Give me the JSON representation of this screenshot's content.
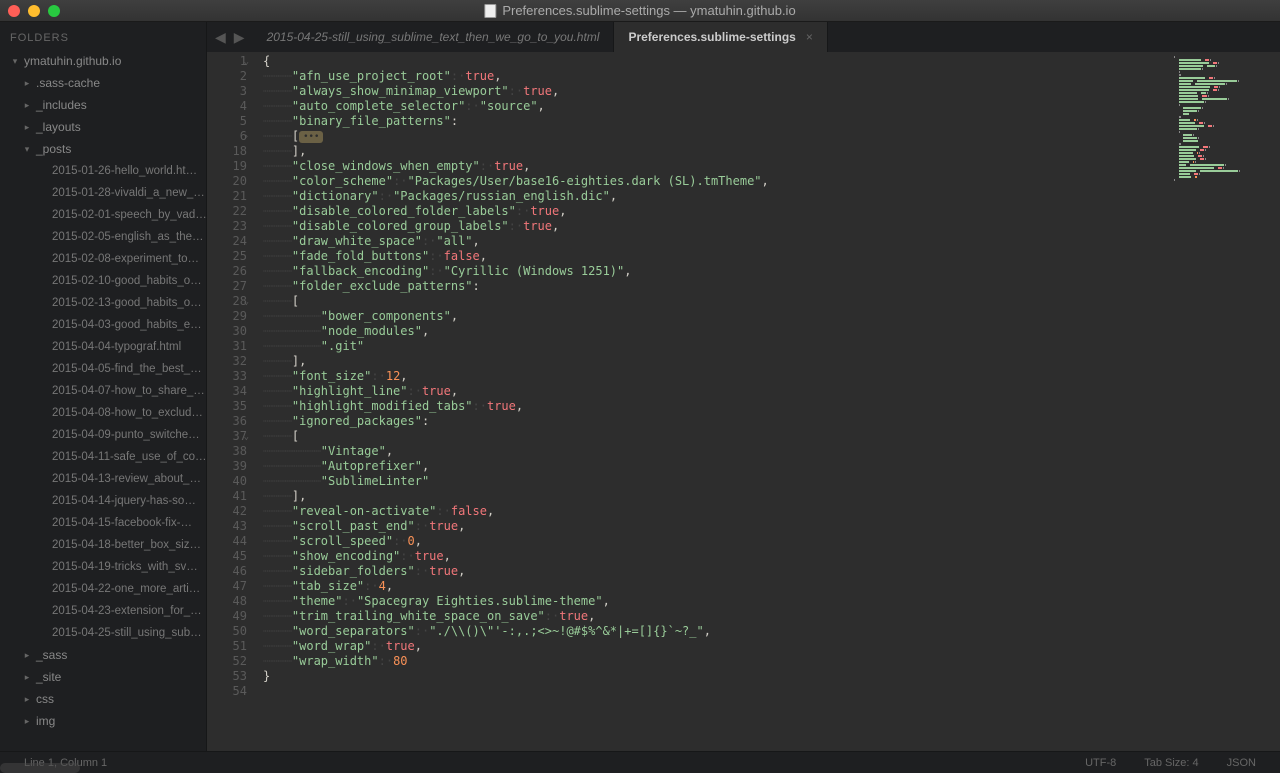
{
  "window": {
    "title": "Preferences.sublime-settings — ymatuhin.github.io"
  },
  "sidebar": {
    "header": "FOLDERS",
    "root": "ymatuhin.github.io",
    "folders": [
      {
        "name": ".sass-cache",
        "expanded": false
      },
      {
        "name": "_includes",
        "expanded": false
      },
      {
        "name": "_layouts",
        "expanded": false
      },
      {
        "name": "_posts",
        "expanded": true
      },
      {
        "name": "_sass",
        "expanded": false
      },
      {
        "name": "_site",
        "expanded": false
      },
      {
        "name": "css",
        "expanded": false
      },
      {
        "name": "img",
        "expanded": false
      }
    ],
    "posts": [
      "2015-01-26-hello_world.ht…",
      "2015-01-28-vivaldi_a_new_…",
      "2015-02-01-speech_by_vad…",
      "2015-02-05-english_as_the…",
      "2015-02-08-experiment_to…",
      "2015-02-10-good_habits_o…",
      "2015-02-13-good_habits_o…",
      "2015-04-03-good_habits_e…",
      "2015-04-04-typograf.html",
      "2015-04-05-find_the_best_…",
      "2015-04-07-how_to_share_…",
      "2015-04-08-how_to_exclud…",
      "2015-04-09-punto_switche…",
      "2015-04-11-safe_use_of_co…",
      "2015-04-13-review_about_…",
      "2015-04-14-jquery-has-so…",
      "2015-04-15-facebook-fix-…",
      "2015-04-18-better_box_siz…",
      "2015-04-19-tricks_with_sv…",
      "2015-04-22-one_more_arti…",
      "2015-04-23-extension_for_…",
      "2015-04-25-still_using_sub…"
    ]
  },
  "tabs": {
    "inactive": "2015-04-25-still_using_sublime_text_then_we_go_to_you.html",
    "active": "Preferences.sublime-settings"
  },
  "code": [
    {
      "n": "1",
      "fold": "down",
      "tokens": [
        {
          "t": "{",
          "c": "punct"
        }
      ]
    },
    {
      "n": "2",
      "tokens": [
        {
          "t": "····",
          "c": "ws"
        },
        {
          "t": "\"afn_use_project_root\"",
          "c": "key"
        },
        {
          "t": ":·",
          "c": "ws"
        },
        {
          "t": "true",
          "c": "bool"
        },
        {
          "t": ",",
          "c": "punct"
        }
      ]
    },
    {
      "n": "3",
      "tokens": [
        {
          "t": "····",
          "c": "ws"
        },
        {
          "t": "\"always_show_minimap_viewport\"",
          "c": "key"
        },
        {
          "t": ":·",
          "c": "ws"
        },
        {
          "t": "true",
          "c": "bool"
        },
        {
          "t": ",",
          "c": "punct"
        }
      ]
    },
    {
      "n": "4",
      "tokens": [
        {
          "t": "····",
          "c": "ws"
        },
        {
          "t": "\"auto_complete_selector\"",
          "c": "key"
        },
        {
          "t": ":·",
          "c": "ws"
        },
        {
          "t": "\"source\"",
          "c": "str"
        },
        {
          "t": ",",
          "c": "punct"
        }
      ]
    },
    {
      "n": "5",
      "tokens": [
        {
          "t": "····",
          "c": "ws"
        },
        {
          "t": "\"binary_file_patterns\"",
          "c": "key"
        },
        {
          "t": ":",
          "c": "punct"
        }
      ]
    },
    {
      "n": "6",
      "fold": "right",
      "tokens": [
        {
          "t": "····",
          "c": "ws"
        },
        {
          "t": "[",
          "c": "punct"
        },
        {
          "t": "…",
          "c": "fold"
        }
      ]
    },
    {
      "n": "18",
      "tokens": [
        {
          "t": "····",
          "c": "ws"
        },
        {
          "t": "],",
          "c": "punct"
        }
      ]
    },
    {
      "n": "19",
      "tokens": [
        {
          "t": "····",
          "c": "ws"
        },
        {
          "t": "\"close_windows_when_empty\"",
          "c": "key"
        },
        {
          "t": ":·",
          "c": "ws"
        },
        {
          "t": "true",
          "c": "bool"
        },
        {
          "t": ",",
          "c": "punct"
        }
      ]
    },
    {
      "n": "20",
      "tokens": [
        {
          "t": "····",
          "c": "ws"
        },
        {
          "t": "\"color_scheme\"",
          "c": "key"
        },
        {
          "t": ":·",
          "c": "ws"
        },
        {
          "t": "\"Packages/User/base16-eighties.dark (SL).tmTheme\"",
          "c": "str"
        },
        {
          "t": ",",
          "c": "punct"
        }
      ]
    },
    {
      "n": "21",
      "tokens": [
        {
          "t": "····",
          "c": "ws"
        },
        {
          "t": "\"dictionary\"",
          "c": "key"
        },
        {
          "t": ":·",
          "c": "ws"
        },
        {
          "t": "\"Packages/russian_english.dic\"",
          "c": "str"
        },
        {
          "t": ",",
          "c": "punct"
        }
      ]
    },
    {
      "n": "22",
      "tokens": [
        {
          "t": "····",
          "c": "ws"
        },
        {
          "t": "\"disable_colored_folder_labels\"",
          "c": "key"
        },
        {
          "t": ":·",
          "c": "ws"
        },
        {
          "t": "true",
          "c": "bool"
        },
        {
          "t": ",",
          "c": "punct"
        }
      ]
    },
    {
      "n": "23",
      "tokens": [
        {
          "t": "····",
          "c": "ws"
        },
        {
          "t": "\"disable_colored_group_labels\"",
          "c": "key"
        },
        {
          "t": ":·",
          "c": "ws"
        },
        {
          "t": "true",
          "c": "bool"
        },
        {
          "t": ",",
          "c": "punct"
        }
      ]
    },
    {
      "n": "24",
      "tokens": [
        {
          "t": "····",
          "c": "ws"
        },
        {
          "t": "\"draw_white_space\"",
          "c": "key"
        },
        {
          "t": ":·",
          "c": "ws"
        },
        {
          "t": "\"all\"",
          "c": "str"
        },
        {
          "t": ",",
          "c": "punct"
        }
      ]
    },
    {
      "n": "25",
      "tokens": [
        {
          "t": "····",
          "c": "ws"
        },
        {
          "t": "\"fade_fold_buttons\"",
          "c": "key"
        },
        {
          "t": ":·",
          "c": "ws"
        },
        {
          "t": "false",
          "c": "bool"
        },
        {
          "t": ",",
          "c": "punct"
        }
      ]
    },
    {
      "n": "26",
      "tokens": [
        {
          "t": "····",
          "c": "ws"
        },
        {
          "t": "\"fallback_encoding\"",
          "c": "key"
        },
        {
          "t": ":·",
          "c": "ws"
        },
        {
          "t": "\"Cyrillic (Windows 1251)\"",
          "c": "str"
        },
        {
          "t": ",",
          "c": "punct"
        }
      ]
    },
    {
      "n": "27",
      "tokens": [
        {
          "t": "····",
          "c": "ws"
        },
        {
          "t": "\"folder_exclude_patterns\"",
          "c": "key"
        },
        {
          "t": ":",
          "c": "punct"
        }
      ]
    },
    {
      "n": "28",
      "fold": "down",
      "tokens": [
        {
          "t": "····",
          "c": "ws"
        },
        {
          "t": "[",
          "c": "punct"
        }
      ]
    },
    {
      "n": "29",
      "tokens": [
        {
          "t": "········",
          "c": "ws"
        },
        {
          "t": "\"bower_components\"",
          "c": "str"
        },
        {
          "t": ",",
          "c": "punct"
        }
      ]
    },
    {
      "n": "30",
      "tokens": [
        {
          "t": "········",
          "c": "ws"
        },
        {
          "t": "\"node_modules\"",
          "c": "str"
        },
        {
          "t": ",",
          "c": "punct"
        }
      ]
    },
    {
      "n": "31",
      "tokens": [
        {
          "t": "········",
          "c": "ws"
        },
        {
          "t": "\".git\"",
          "c": "str"
        }
      ]
    },
    {
      "n": "32",
      "tokens": [
        {
          "t": "····",
          "c": "ws"
        },
        {
          "t": "],",
          "c": "punct"
        }
      ]
    },
    {
      "n": "33",
      "tokens": [
        {
          "t": "····",
          "c": "ws"
        },
        {
          "t": "\"font_size\"",
          "c": "key"
        },
        {
          "t": ":·",
          "c": "ws"
        },
        {
          "t": "12",
          "c": "num"
        },
        {
          "t": ",",
          "c": "punct"
        }
      ]
    },
    {
      "n": "34",
      "tokens": [
        {
          "t": "····",
          "c": "ws"
        },
        {
          "t": "\"highlight_line\"",
          "c": "key"
        },
        {
          "t": ":·",
          "c": "ws"
        },
        {
          "t": "true",
          "c": "bool"
        },
        {
          "t": ",",
          "c": "punct"
        }
      ]
    },
    {
      "n": "35",
      "tokens": [
        {
          "t": "····",
          "c": "ws"
        },
        {
          "t": "\"highlight_modified_tabs\"",
          "c": "key"
        },
        {
          "t": ":·",
          "c": "ws"
        },
        {
          "t": "true",
          "c": "bool"
        },
        {
          "t": ",",
          "c": "punct"
        }
      ]
    },
    {
      "n": "36",
      "tokens": [
        {
          "t": "····",
          "c": "ws"
        },
        {
          "t": "\"ignored_packages\"",
          "c": "key"
        },
        {
          "t": ":",
          "c": "punct"
        }
      ]
    },
    {
      "n": "37",
      "fold": "down",
      "tokens": [
        {
          "t": "····",
          "c": "ws"
        },
        {
          "t": "[",
          "c": "punct"
        }
      ]
    },
    {
      "n": "38",
      "tokens": [
        {
          "t": "········",
          "c": "ws"
        },
        {
          "t": "\"Vintage\"",
          "c": "str"
        },
        {
          "t": ",",
          "c": "punct"
        }
      ]
    },
    {
      "n": "39",
      "tokens": [
        {
          "t": "········",
          "c": "ws"
        },
        {
          "t": "\"Autoprefixer\"",
          "c": "str"
        },
        {
          "t": ",",
          "c": "punct"
        }
      ]
    },
    {
      "n": "40",
      "tokens": [
        {
          "t": "········",
          "c": "ws"
        },
        {
          "t": "\"SublimeLinter\"",
          "c": "str"
        }
      ]
    },
    {
      "n": "41",
      "tokens": [
        {
          "t": "····",
          "c": "ws"
        },
        {
          "t": "],",
          "c": "punct"
        }
      ]
    },
    {
      "n": "42",
      "tokens": [
        {
          "t": "····",
          "c": "ws"
        },
        {
          "t": "\"reveal-on-activate\"",
          "c": "key"
        },
        {
          "t": ":·",
          "c": "ws"
        },
        {
          "t": "false",
          "c": "bool"
        },
        {
          "t": ",",
          "c": "punct"
        }
      ]
    },
    {
      "n": "43",
      "tokens": [
        {
          "t": "····",
          "c": "ws"
        },
        {
          "t": "\"scroll_past_end\"",
          "c": "key"
        },
        {
          "t": ":·",
          "c": "ws"
        },
        {
          "t": "true",
          "c": "bool"
        },
        {
          "t": ",",
          "c": "punct"
        }
      ]
    },
    {
      "n": "44",
      "tokens": [
        {
          "t": "····",
          "c": "ws"
        },
        {
          "t": "\"scroll_speed\"",
          "c": "key"
        },
        {
          "t": ":·",
          "c": "ws"
        },
        {
          "t": "0",
          "c": "num"
        },
        {
          "t": ",",
          "c": "punct"
        }
      ]
    },
    {
      "n": "45",
      "tokens": [
        {
          "t": "····",
          "c": "ws"
        },
        {
          "t": "\"show_encoding\"",
          "c": "key"
        },
        {
          "t": ":·",
          "c": "ws"
        },
        {
          "t": "true",
          "c": "bool"
        },
        {
          "t": ",",
          "c": "punct"
        }
      ]
    },
    {
      "n": "46",
      "tokens": [
        {
          "t": "····",
          "c": "ws"
        },
        {
          "t": "\"sidebar_folders\"",
          "c": "key"
        },
        {
          "t": ":·",
          "c": "ws"
        },
        {
          "t": "true",
          "c": "bool"
        },
        {
          "t": ",",
          "c": "punct"
        }
      ]
    },
    {
      "n": "47",
      "tokens": [
        {
          "t": "····",
          "c": "ws"
        },
        {
          "t": "\"tab_size\"",
          "c": "key"
        },
        {
          "t": ":·",
          "c": "ws"
        },
        {
          "t": "4",
          "c": "num"
        },
        {
          "t": ",",
          "c": "punct"
        }
      ]
    },
    {
      "n": "48",
      "tokens": [
        {
          "t": "····",
          "c": "ws"
        },
        {
          "t": "\"theme\"",
          "c": "key"
        },
        {
          "t": ":·",
          "c": "ws"
        },
        {
          "t": "\"Spacegray Eighties.sublime-theme\"",
          "c": "str"
        },
        {
          "t": ",",
          "c": "punct"
        }
      ]
    },
    {
      "n": "49",
      "tokens": [
        {
          "t": "····",
          "c": "ws"
        },
        {
          "t": "\"trim_trailing_white_space_on_save\"",
          "c": "key"
        },
        {
          "t": ":·",
          "c": "ws"
        },
        {
          "t": "true",
          "c": "bool"
        },
        {
          "t": ",",
          "c": "punct"
        }
      ]
    },
    {
      "n": "50",
      "tokens": [
        {
          "t": "····",
          "c": "ws"
        },
        {
          "t": "\"word_separators\"",
          "c": "key"
        },
        {
          "t": ":·",
          "c": "ws"
        },
        {
          "t": "\"./\\\\()\\\"'-:,.;<>~!@#$%^&*|+=[]{}`~?_\"",
          "c": "str"
        },
        {
          "t": ",",
          "c": "punct"
        }
      ]
    },
    {
      "n": "51",
      "tokens": [
        {
          "t": "····",
          "c": "ws"
        },
        {
          "t": "\"word_wrap\"",
          "c": "key"
        },
        {
          "t": ":·",
          "c": "ws"
        },
        {
          "t": "true",
          "c": "bool"
        },
        {
          "t": ",",
          "c": "punct"
        }
      ]
    },
    {
      "n": "52",
      "tokens": [
        {
          "t": "····",
          "c": "ws"
        },
        {
          "t": "\"wrap_width\"",
          "c": "key"
        },
        {
          "t": ":·",
          "c": "ws"
        },
        {
          "t": "80",
          "c": "num"
        }
      ]
    },
    {
      "n": "53",
      "tokens": [
        {
          "t": "}",
          "c": "punct"
        }
      ]
    },
    {
      "n": "54",
      "tokens": []
    }
  ],
  "statusbar": {
    "position": "Line 1, Column 1",
    "encoding": "UTF-8",
    "tabsize": "Tab Size: 4",
    "syntax": "JSON"
  }
}
